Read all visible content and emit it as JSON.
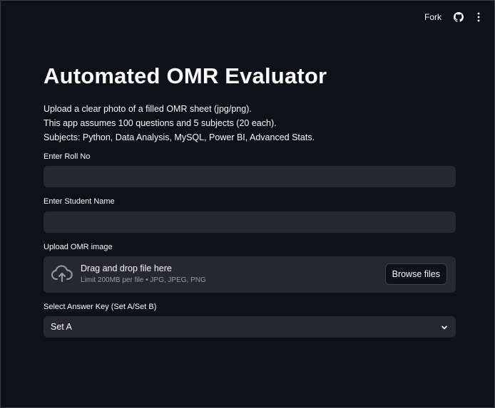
{
  "header": {
    "fork_label": "Fork",
    "github_icon": "github-icon",
    "menu_icon": "vertical-ellipsis-icon"
  },
  "main": {
    "title": "Automated OMR Evaluator",
    "description": [
      "Upload a clear photo of a filled OMR sheet (jpg/png).",
      "This app assumes 100 questions and 5 subjects (20 each).",
      "Subjects: Python, Data Analysis, MySQL, Power BI, Advanced Stats."
    ],
    "roll_no": {
      "label": "Enter Roll No",
      "value": ""
    },
    "student_name": {
      "label": "Enter Student Name",
      "value": ""
    },
    "uploader": {
      "label": "Upload OMR image",
      "drag_text": "Drag and drop file here",
      "limit_text": "Limit 200MB per file • JPG, JPEG, PNG",
      "browse_label": "Browse files",
      "icon": "cloud-upload-icon"
    },
    "answer_key": {
      "label": "Select Answer Key (Set A/Set B)",
      "selected": "Set A",
      "icon": "chevron-down-icon"
    }
  },
  "colors": {
    "background": "#0e1117",
    "input_bg": "#262730",
    "text": "#fafafa",
    "muted_text": "#9a9ba3"
  }
}
